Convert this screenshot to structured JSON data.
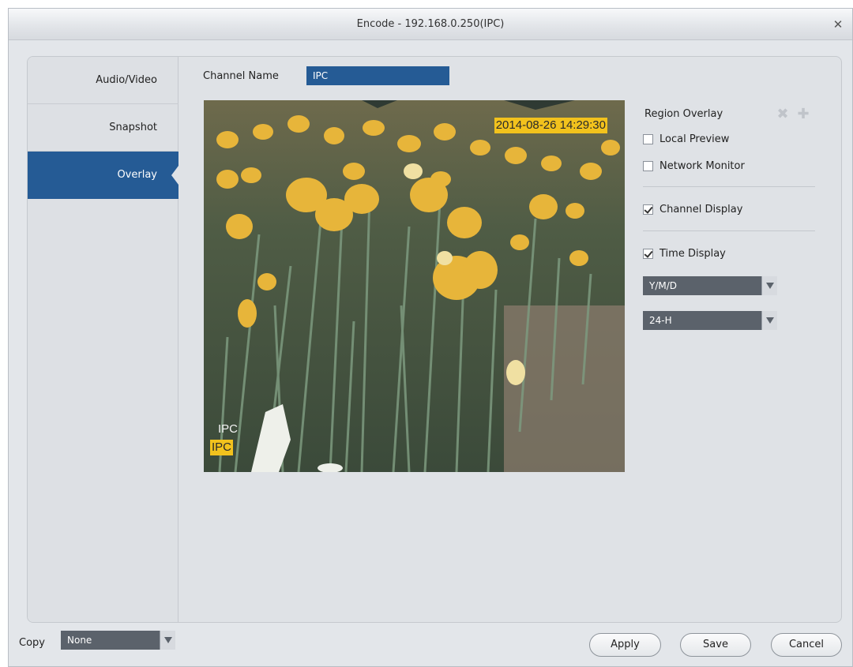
{
  "window": {
    "title": "Encode  - 192.168.0.250(IPC)"
  },
  "sidebar": {
    "items": [
      {
        "label": "Audio/Video"
      },
      {
        "label": "Snapshot"
      },
      {
        "label": "Overlay",
        "active": true
      }
    ]
  },
  "channel_name": {
    "label": "Channel Name",
    "value": "IPC"
  },
  "preview": {
    "time_osd": "2014-08-26 14:29:30",
    "channel_osd": "IPC",
    "channel_osd_shadow": "IPC"
  },
  "overlay": {
    "region_overlay_label": "Region Overlay",
    "delete_icon": "close-x-icon",
    "add_icon": "plus-icon",
    "local_preview": {
      "label": "Local Preview",
      "checked": false
    },
    "network_monitor": {
      "label": "Network Monitor",
      "checked": false
    },
    "channel_display": {
      "label": "Channel Display",
      "checked": true
    },
    "time_display": {
      "label": "Time Display",
      "checked": true
    },
    "date_format": "Y/M/D",
    "time_format": "24-H"
  },
  "footer": {
    "copy_label": "Copy",
    "copy_value": "None",
    "apply": "Apply",
    "save": "Save",
    "cancel": "Cancel"
  },
  "colors": {
    "accent": "#255b95",
    "osd": "#f2c21d",
    "dropdown": "#5b626b"
  }
}
